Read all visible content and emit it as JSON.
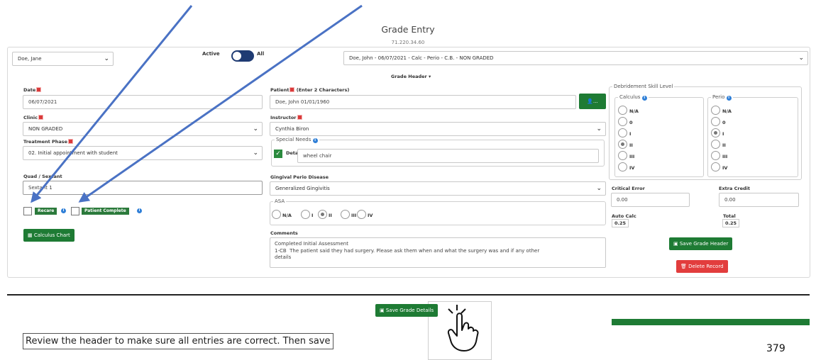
{
  "header": {
    "title": "Grade Entry",
    "ip": "71.220.34.60"
  },
  "top": {
    "student_select": "Doe, Jane",
    "toggle_left": "Active",
    "toggle_right": "All",
    "record_select": "Doe, John - 06/07/2021 - Calc - Perio - C.B. - NON GRADED"
  },
  "grade_header_label": "Grade Header ▾",
  "left": {
    "date_label": "Date",
    "date_value": "06/07/2021",
    "clinic_label": "Clinic",
    "clinic_value": "NON GRADED",
    "phase_label": "Treatment Phase",
    "phase_value": "02. Initial appointment with student",
    "quad_label": "Quad / Sextant",
    "quad_value": "Sextant 1",
    "recare_label": "Recare",
    "patient_complete_label": "Patient Complete",
    "calculus_chart_button": "Calculus Chart"
  },
  "middle": {
    "patient_label": "Patient",
    "patient_hint": "(Enter 2 Characters)",
    "patient_value": "Doe, John 01/01/1960",
    "patient_button": "...",
    "instructor_label": "Instructor",
    "instructor_value": "Cynthia Biron",
    "special_needs_legend": "Special Needs",
    "details_label": "Details",
    "details_value": "wheel chair",
    "gingival_label": "Gingival Perio Disease",
    "gingival_value": "Generalized Gingivitis",
    "asa_legend": "ASA",
    "asa_options": [
      "N/A",
      "I",
      "II",
      "III",
      "IV"
    ],
    "asa_selected": "II",
    "comments_label": "Comments",
    "comments_value": "Completed Initial Assessment\n1-CB  The patient said they had surgery. Please ask them when and what the surgery was and if any other\ndetails"
  },
  "right": {
    "debridement_legend": "Debridement Skill Level",
    "calculus_legend": "Calculus",
    "perio_legend": "Perio",
    "levels": [
      "N/A",
      "0",
      "I",
      "II",
      "III",
      "IV"
    ],
    "calculus_selected": "II",
    "perio_selected": "I",
    "critical_error_label": "Critical Error",
    "critical_error_value": "0.00",
    "extra_credit_label": "Extra Credit",
    "extra_credit_value": "0.00",
    "auto_calc_label": "Auto Calc",
    "auto_calc_value": "0.25",
    "total_label": "Total",
    "total_value": "0.25",
    "save_header_button": "Save Grade Header",
    "delete_button": "Delete Record"
  },
  "bottom": {
    "save_details_button": "Save Grade Details",
    "caption": "Review the header to make sure all entries are correct.  Then save",
    "page_number": "379"
  },
  "colors": {
    "green": "#1e7b34",
    "red": "#e23d3d",
    "arrow": "#4a72c4",
    "toggle": "#1f3b73"
  }
}
